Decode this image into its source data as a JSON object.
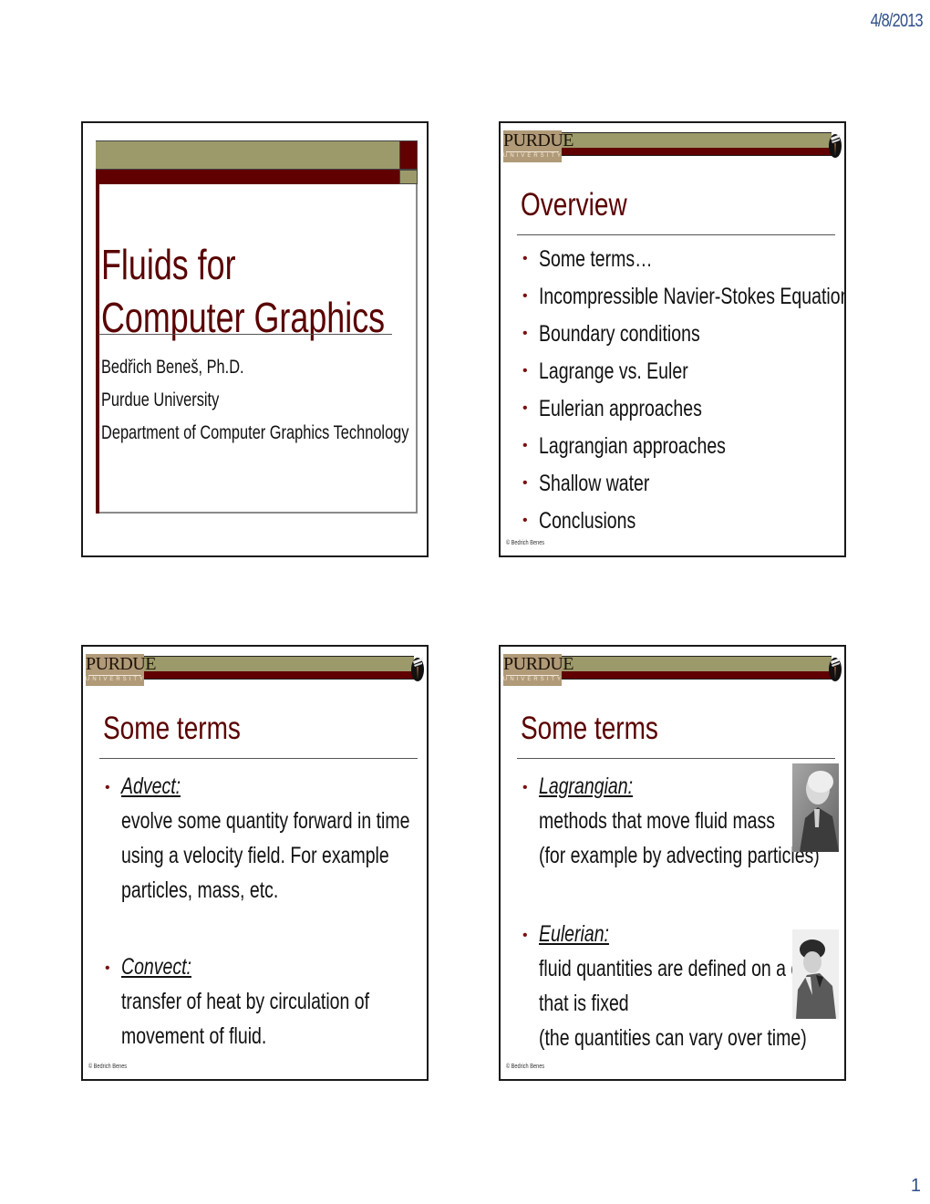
{
  "page": {
    "date": "4/8/2013",
    "page_number": "1"
  },
  "colors": {
    "maroon": "#600000",
    "olive": "#9c9a6a",
    "logo_tan": "#b09a78",
    "date_blue": "#2f4f8a"
  },
  "logo": {
    "main": "PURDUE",
    "sub": "UNIVERSITY",
    "end_icon": "quill-emblem-icon"
  },
  "slides": [
    {
      "type": "title",
      "title_lines": [
        "Fluids for",
        "Computer Graphics"
      ],
      "subtitle_lines": [
        "Bedřich Beneš, Ph.D.",
        "Purdue University",
        "Department of Computer Graphics Technology"
      ]
    },
    {
      "type": "bullets",
      "title": "Overview",
      "bullets": [
        "Some terms…",
        "Incompressible Navier-Stokes Equations",
        "Boundary conditions",
        "Lagrange vs. Euler",
        "Eulerian approaches",
        "Lagrangian approaches",
        "Shallow water",
        "Conclusions"
      ],
      "footer": "© Bedrich Benes"
    },
    {
      "type": "terms",
      "title": "Some terms",
      "terms": [
        {
          "term": "Advect:",
          "lines": [
            "evolve some quantity forward in time",
            "using a velocity field. For example",
            "particles, mass, etc."
          ]
        },
        {
          "term": "Convect:",
          "lines": [
            "transfer of heat by circulation of",
            "movement of fluid."
          ]
        }
      ],
      "footer": "© Bedrich Benes"
    },
    {
      "type": "terms",
      "title": "Some terms",
      "terms": [
        {
          "term": "Lagrangian:",
          "lines": [
            "methods that move fluid mass",
            "(for example by advecting particles)"
          ],
          "image": "portrait-lagrange"
        },
        {
          "term": "Eulerian:",
          "lines": [
            "fluid quantities are defined on a grid",
            "that is fixed",
            "(the quantities can vary over time)"
          ],
          "image": "portrait-euler"
        }
      ],
      "footer": "© Bedrich Benes"
    }
  ]
}
